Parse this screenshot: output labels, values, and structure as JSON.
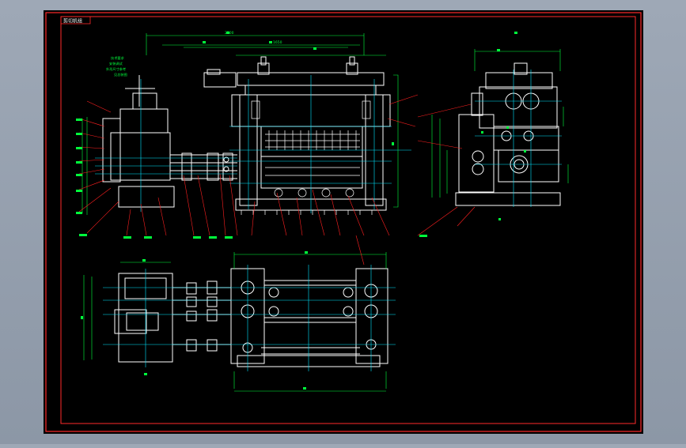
{
  "colors": {
    "background": "#000000",
    "frame": "#ff2a2a",
    "geometry": "#ffffff",
    "centerline": "#00e5ff",
    "dimension": "#00ff3c",
    "leader": "#ff2020"
  },
  "title_tab": "剪切机组",
  "notes": {
    "line1": "技术要求",
    "line2": "安装调试",
    "line3": "外形尺寸参考",
    "line4": "见总装图"
  },
  "labels": {
    "top_width": "2200",
    "top_inner": "1650"
  }
}
